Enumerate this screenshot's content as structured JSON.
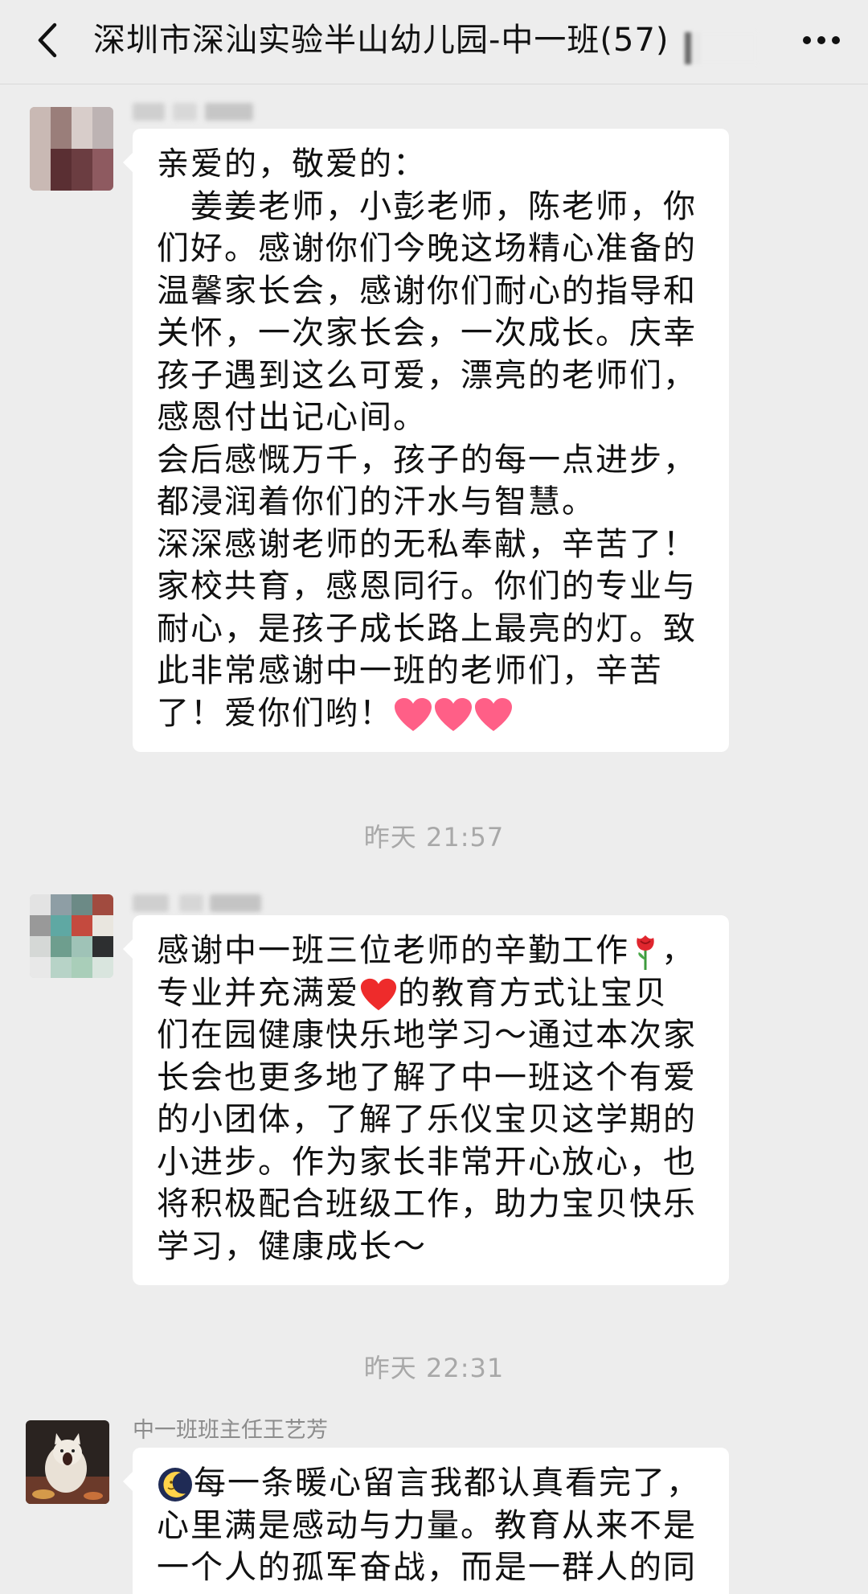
{
  "header": {
    "title": "深圳市深汕实验半山幼儿园-中一班(57)",
    "back_icon": "chevron-left-icon",
    "more_icon": "ellipsis-icon"
  },
  "messages": [
    {
      "lines": [
        "亲爱的，敬爱的：",
        "　姜姜老师，小彭老师，陈老师，你",
        "们好。感谢你们今晚这场精心准备的",
        "温馨家长会，感谢你们耐心的指导和",
        "关怀，一次家长会，一次成长。庆幸",
        "孩子遇到这么可爱，漂亮的老师们，",
        "感恩付出记心间。",
        "会后感慨万千，孩子的每一点进步，",
        "都浸润着你们的汗水与智慧。",
        "深深感谢老师的无私奉献，辛苦了！",
        "家校共育，感恩同行。你们的专业与",
        "耐心，是孩子成长路上最亮的灯。致",
        "此非常感谢中一班的老师们，辛苦",
        "了！爱你们哟！"
      ],
      "emoji": [
        "pink-heart",
        "pink-heart",
        "pink-heart"
      ]
    },
    {
      "lines": [
        "感谢中一班三位老师的辛勤工作",
        "专业并充满爱",
        "们在园健康快乐地学习～通过本次家",
        "长会也更多地了解了中一班这个有爱",
        "的小团体，了解了乐仪宝贝这学期的",
        "小进步。作为家长非常开心放心，也",
        "将积极配合班级工作，助力宝贝快乐",
        "学习，健康成长～"
      ],
      "line1_suffix": "，",
      "line2_suffix": "的教育方式让宝贝",
      "emoji": [
        "rose",
        "red-heart"
      ]
    },
    {
      "sender": "中一班班主任王艺芳",
      "lines": [
        "每一条暖心留言我都认真看完了，",
        "心里满是感动与力量。教育从来不是",
        "一个人的孤军奋战，而是一群人的同"
      ],
      "emoji": [
        "moon-face"
      ]
    }
  ],
  "timestamps": [
    "昨天 21:57",
    "昨天 22:31"
  ]
}
